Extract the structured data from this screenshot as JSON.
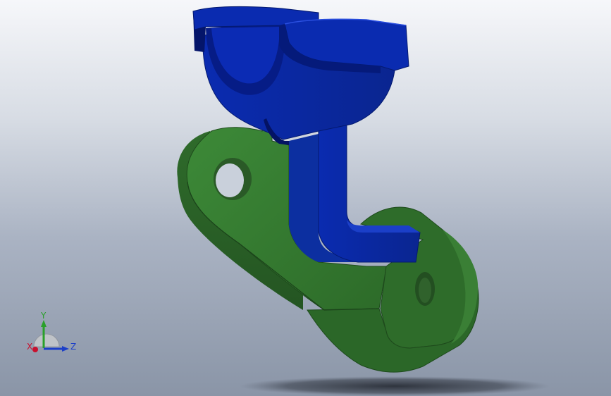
{
  "viewport": {
    "background_top": "#f6f7fa",
    "background_bottom": "#8a95a7"
  },
  "model": {
    "bracket_color": "#2f6e2c",
    "clamp_color": "#0b2aa8"
  },
  "triad": {
    "x_label": "X",
    "y_label": "Y",
    "z_label": "Z",
    "x_color": "#c8102e",
    "y_color": "#2aa02a",
    "z_color": "#1c3fc8"
  }
}
